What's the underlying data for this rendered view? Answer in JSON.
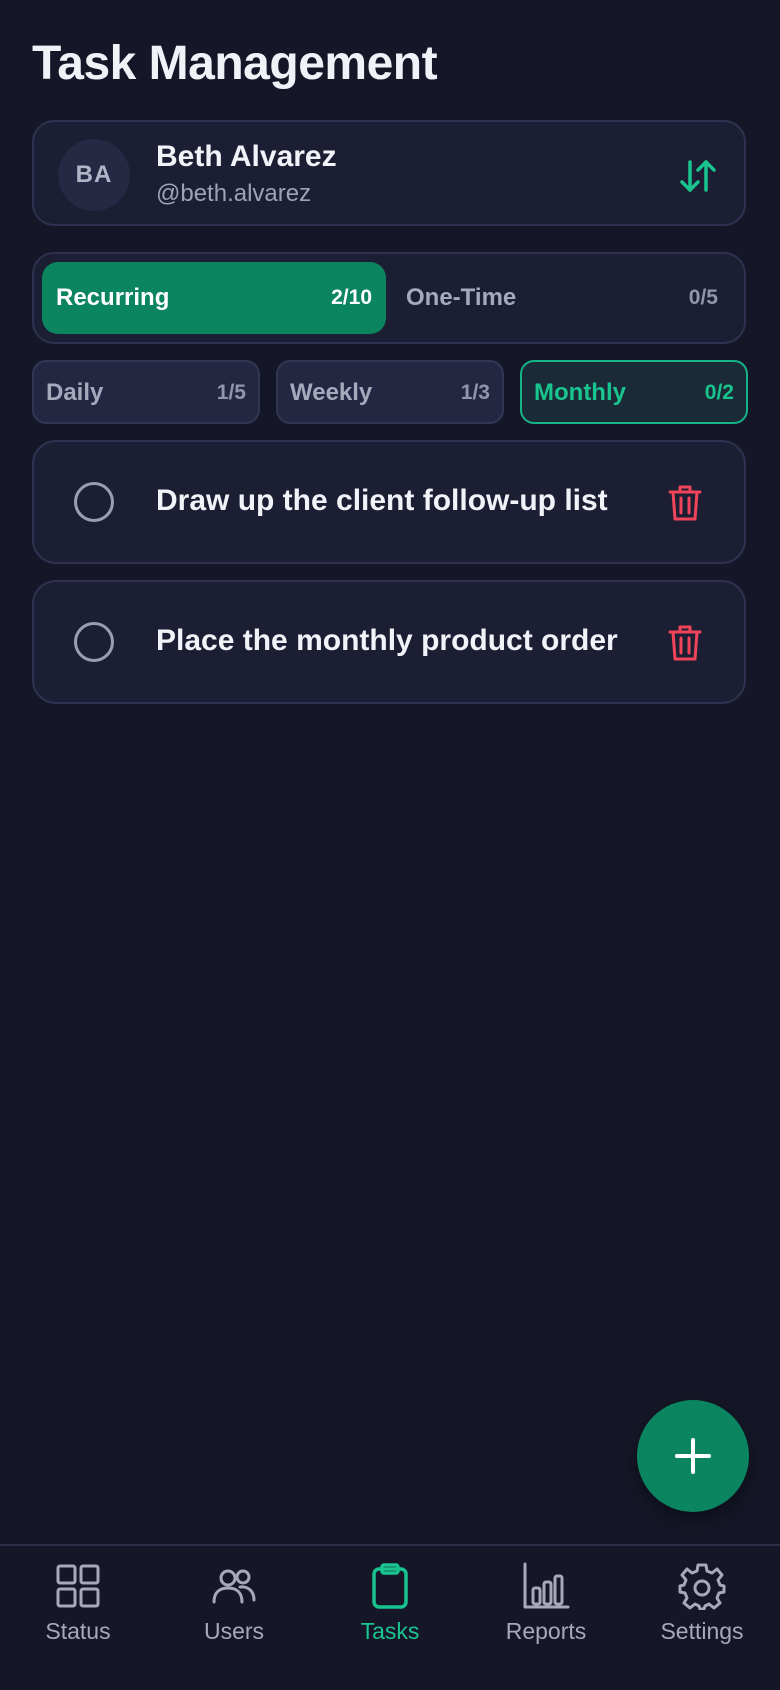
{
  "page": {
    "title": "Task Management"
  },
  "user": {
    "initials": "BA",
    "name": "Beth Alvarez",
    "handle": "@beth.alvarez"
  },
  "segments": [
    {
      "label": "Recurring",
      "count": "2/10",
      "active": true
    },
    {
      "label": "One-Time",
      "count": "0/5",
      "active": false
    }
  ],
  "filters": [
    {
      "label": "Daily",
      "count": "1/5",
      "active": false
    },
    {
      "label": "Weekly",
      "count": "1/3",
      "active": false
    },
    {
      "label": "Monthly",
      "count": "0/2",
      "active": true
    }
  ],
  "tasks": [
    {
      "text": "Draw up the client follow-up list",
      "done": false
    },
    {
      "text": "Place the monthly product order",
      "done": false
    }
  ],
  "nav": {
    "items": [
      {
        "label": "Status",
        "icon": "grid-icon"
      },
      {
        "label": "Users",
        "icon": "users-icon"
      },
      {
        "label": "Tasks",
        "icon": "clipboard-icon",
        "active": true
      },
      {
        "label": "Reports",
        "icon": "bar-chart-icon"
      },
      {
        "label": "Settings",
        "icon": "gear-icon"
      }
    ]
  },
  "colors": {
    "accent": "#0b8560",
    "accent_text": "#19c48e",
    "danger": "#f0445a",
    "background": "#151728"
  }
}
